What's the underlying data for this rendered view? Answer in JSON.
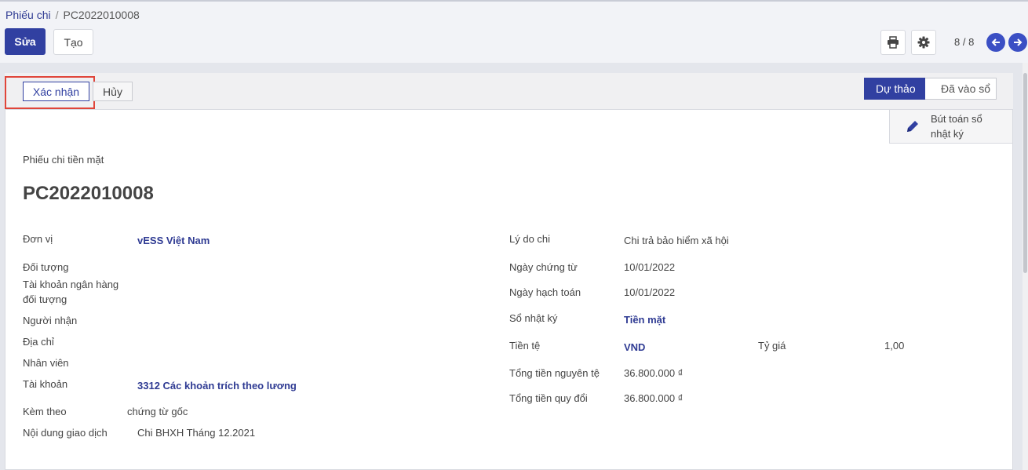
{
  "breadcrumb": {
    "parent": "Phiếu chi",
    "separator": "/",
    "current": "PC2022010008"
  },
  "toolbar": {
    "edit_label": "Sửa",
    "create_label": "Tạo"
  },
  "pager": {
    "value": "8 / 8"
  },
  "statusbar": {
    "confirm_label": "Xác nhận",
    "cancel_label": "Hủy",
    "stages": [
      {
        "label": "Dự thảo"
      },
      {
        "label": "Đã vào sổ"
      }
    ]
  },
  "smart_button": {
    "line1": "Bút toán sổ",
    "line2": "nhật ký"
  },
  "document": {
    "type_label": "Phiếu chi tiền mặt",
    "number": "PC2022010008"
  },
  "left_fields": {
    "don_vi": {
      "label": "Đơn vị",
      "value": "vESS Việt Nam"
    },
    "doi_tuong": {
      "label": "Đối tượng",
      "value": ""
    },
    "tai_khoan_ngan_hang": {
      "label_line1": "Tài khoản ngân hàng",
      "label_line2": "đối tượng",
      "value": ""
    },
    "nguoi_nhan": {
      "label": "Người nhận",
      "value": ""
    },
    "dia_chi": {
      "label": "Địa chỉ",
      "value": ""
    },
    "nhan_vien": {
      "label": "Nhân viên",
      "value": ""
    },
    "tai_khoan": {
      "label": "Tài khoản",
      "value": "3312 Các khoản trích theo lương"
    },
    "kem_theo": {
      "label": "Kèm theo",
      "value": "chứng từ gốc"
    },
    "noi_dung": {
      "label": "Nội dung giao dịch",
      "value": "Chi BHXH Tháng 12.2021"
    }
  },
  "right_fields": {
    "ly_do_chi": {
      "label": "Lý do chi",
      "value": "Chi trả bảo hiểm xã hội"
    },
    "ngay_chung_tu": {
      "label": "Ngày chứng từ",
      "value": "10/01/2022"
    },
    "ngay_hach_toan": {
      "label": "Ngày hạch toán",
      "value": "10/01/2022"
    },
    "so_nhat_ky": {
      "label": "Sổ nhật ký",
      "value": "Tiền mặt"
    },
    "tien_te": {
      "label": "Tiền tệ",
      "value": "VND"
    },
    "ty_gia": {
      "label": "Tỷ giá",
      "value": "1,00"
    },
    "tong_nguyen_te": {
      "label": "Tổng tiền nguyên tệ",
      "value": "36.800.000 ₫"
    },
    "tong_quy_doi": {
      "label": "Tổng tiền quy đổi",
      "value": "36.800.000 ₫"
    }
  },
  "colors": {
    "primary": "#3140a1",
    "link": "#2f3b93",
    "highlight": "#e0453a"
  },
  "icons": {
    "print": "printer-icon",
    "settings": "gear-icon",
    "prev": "arrow-left-icon",
    "next": "arrow-right-icon",
    "journal": "pencil-icon"
  }
}
